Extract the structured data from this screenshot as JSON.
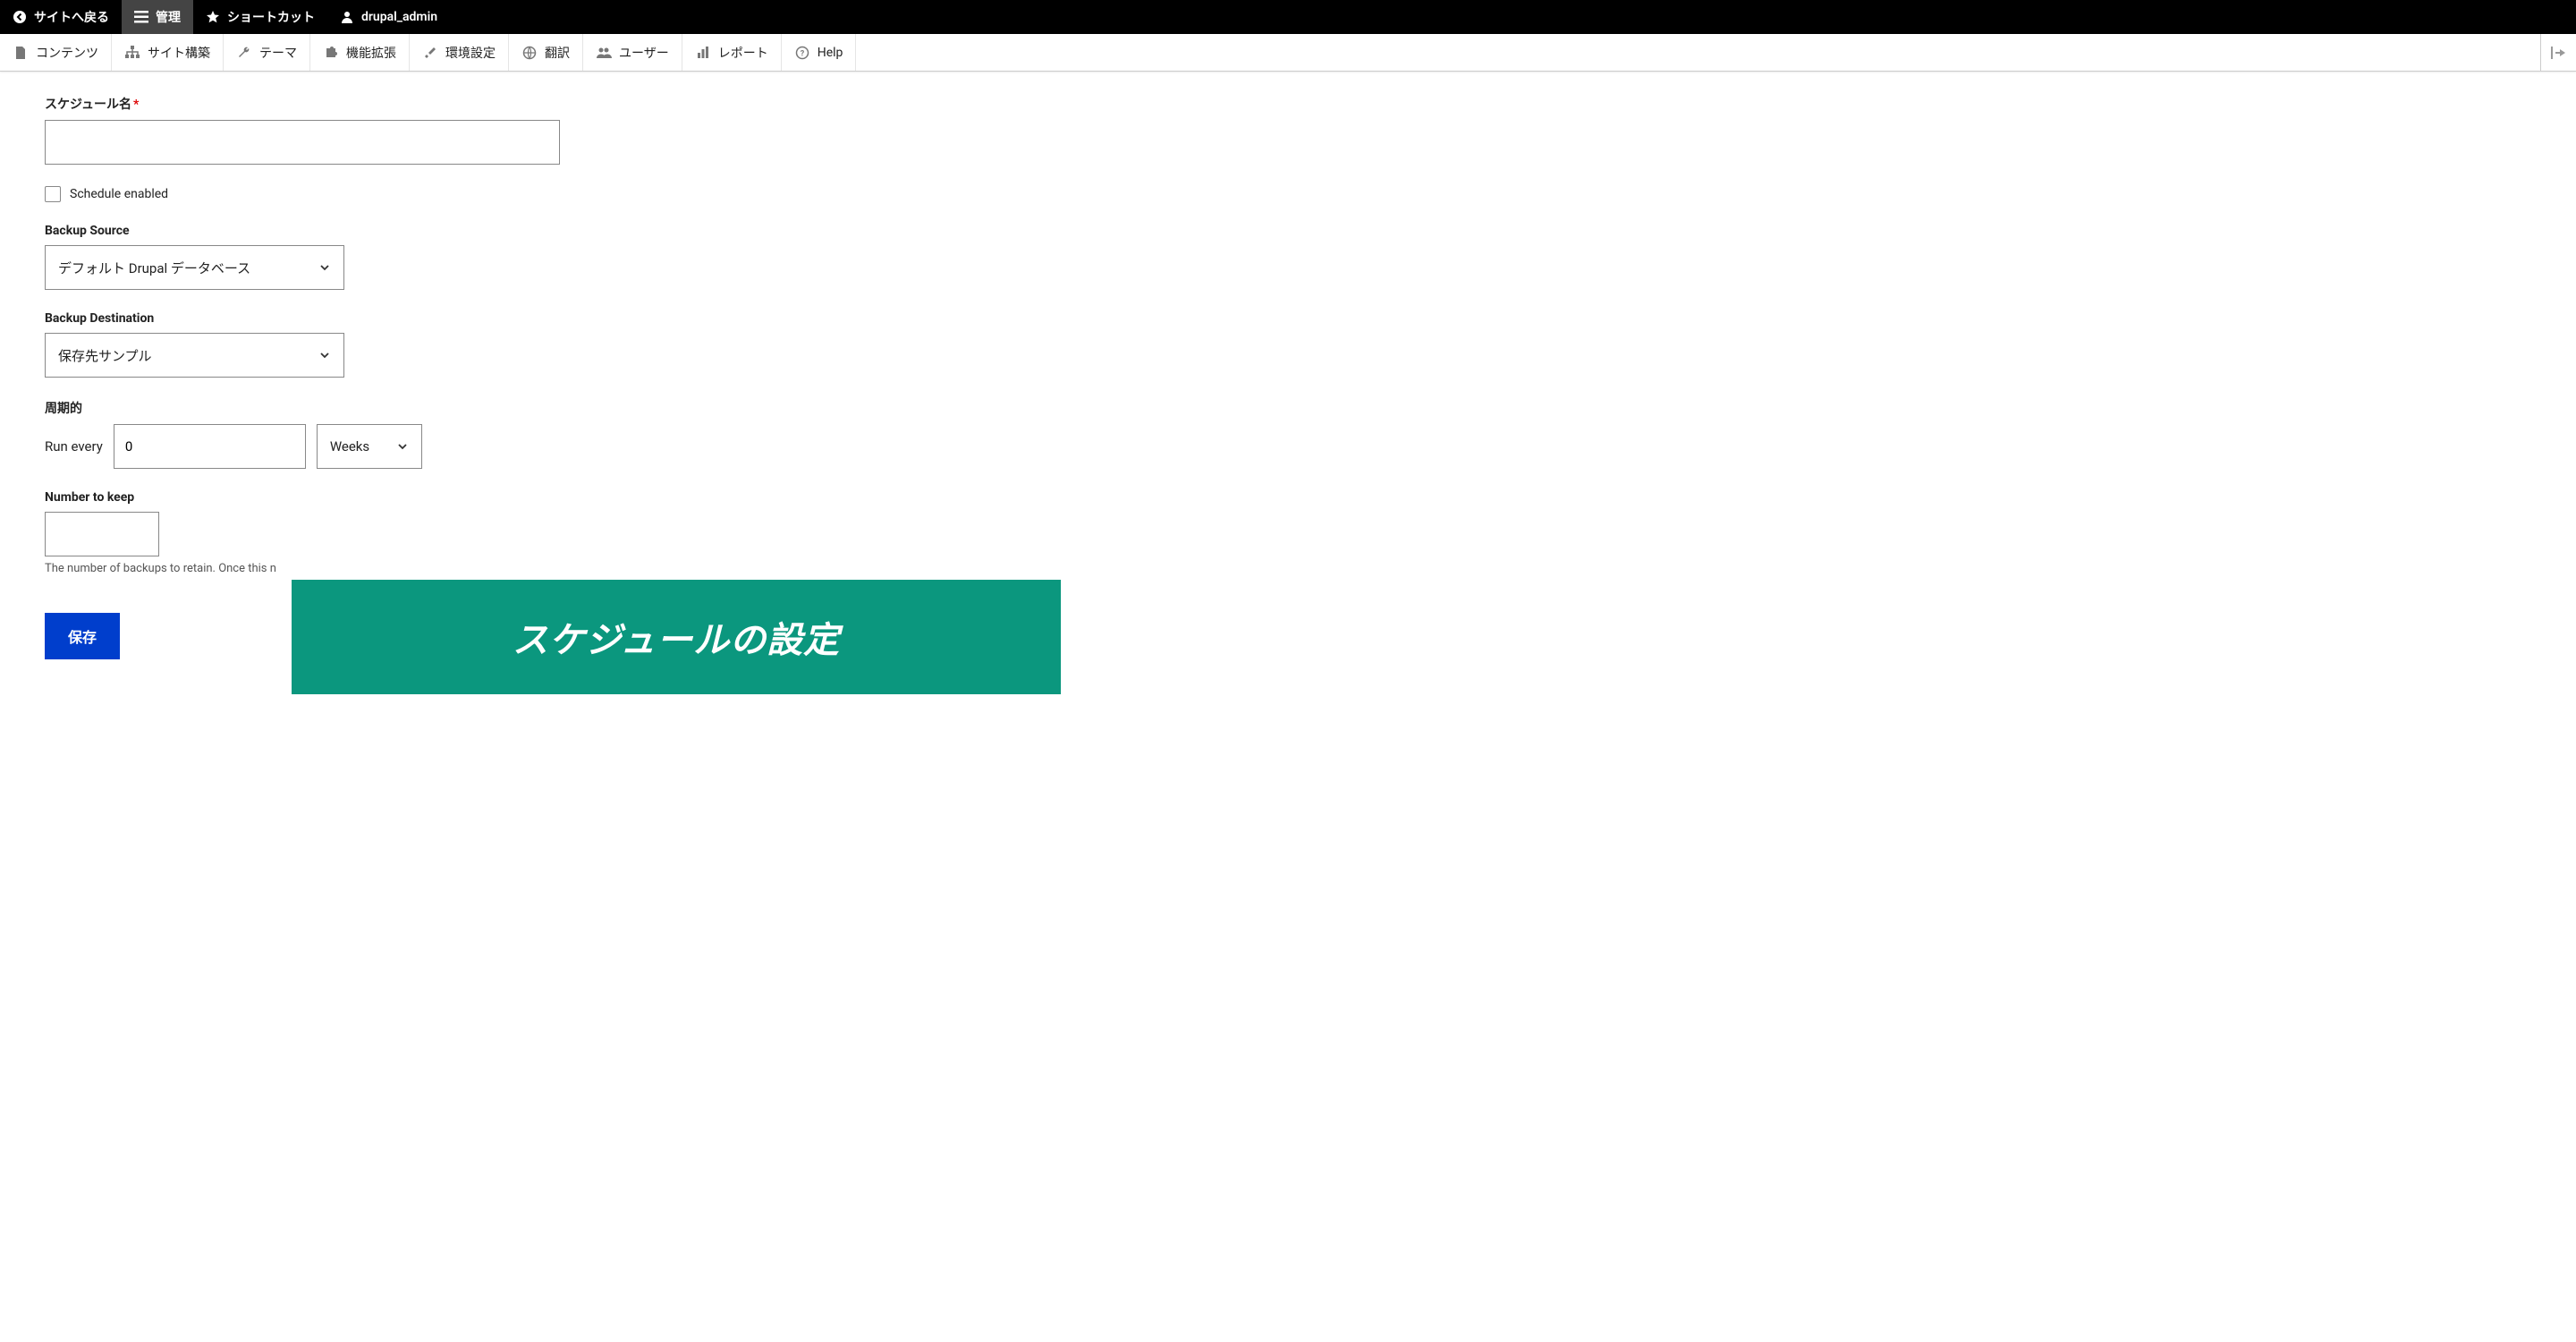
{
  "topbar": {
    "back": "サイトへ戻る",
    "manage": "管理",
    "shortcuts": "ショートカット",
    "user": "drupal_admin"
  },
  "adminbar": {
    "content": "コンテンツ",
    "structure": "サイト構築",
    "appearance": "テーマ",
    "extend": "機能拡張",
    "config": "環境設定",
    "translate": "翻訳",
    "people": "ユーザー",
    "reports": "レポート",
    "help": "Help"
  },
  "form": {
    "name_label": "スケジュール名",
    "name_value": "",
    "schedule_enabled_label": "Schedule enabled",
    "source_label": "Backup Source",
    "source_value": "デフォルト Drupal データベース",
    "destination_label": "Backup Destination",
    "destination_value": "保存先サンプル",
    "frequency_label": "周期的",
    "run_every_label": "Run every",
    "run_every_value": "0",
    "period_value": "Weeks",
    "keep_label": "Number to keep",
    "keep_value": "",
    "keep_desc": "The number of backups to retain. Once this n",
    "save_btn": "保存"
  },
  "banner": "スケジュールの設定"
}
